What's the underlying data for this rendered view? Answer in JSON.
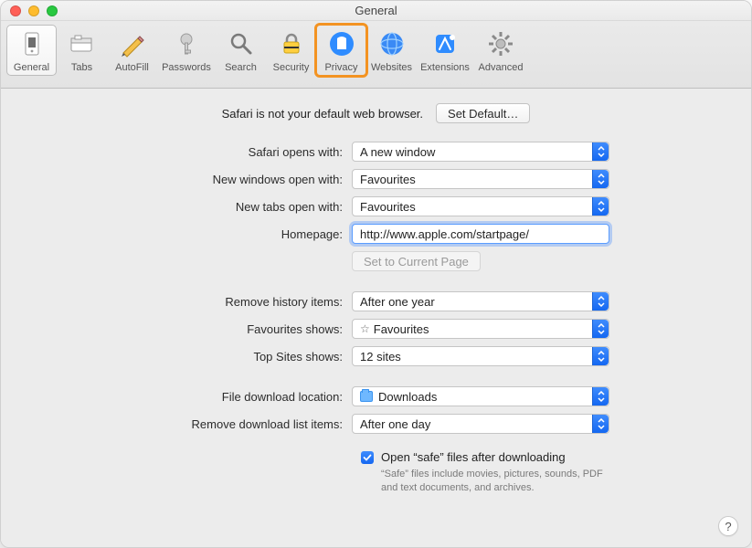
{
  "window": {
    "title": "General"
  },
  "toolbar": {
    "items": [
      {
        "id": "general",
        "label": "General"
      },
      {
        "id": "tabs",
        "label": "Tabs"
      },
      {
        "id": "autofill",
        "label": "AutoFill"
      },
      {
        "id": "passwords",
        "label": "Passwords"
      },
      {
        "id": "search",
        "label": "Search"
      },
      {
        "id": "security",
        "label": "Security"
      },
      {
        "id": "privacy",
        "label": "Privacy"
      },
      {
        "id": "websites",
        "label": "Websites"
      },
      {
        "id": "extensions",
        "label": "Extensions"
      },
      {
        "id": "advanced",
        "label": "Advanced"
      }
    ],
    "selected": "general",
    "highlighted": "privacy"
  },
  "default_browser": {
    "message": "Safari is not your default web browser.",
    "button": "Set Default…"
  },
  "form": {
    "opens_with": {
      "label": "Safari opens with:",
      "value": "A new window"
    },
    "new_windows": {
      "label": "New windows open with:",
      "value": "Favourites"
    },
    "new_tabs": {
      "label": "New tabs open with:",
      "value": "Favourites"
    },
    "homepage": {
      "label": "Homepage:",
      "value": "http://www.apple.com/startpage/"
    },
    "set_current": {
      "label": "Set to Current Page"
    },
    "remove_history": {
      "label": "Remove history items:",
      "value": "After one year"
    },
    "favourites_shows": {
      "label": "Favourites shows:",
      "value": "Favourites"
    },
    "top_sites": {
      "label": "Top Sites shows:",
      "value": "12 sites"
    },
    "download_location": {
      "label": "File download location:",
      "value": "Downloads"
    },
    "remove_downloads": {
      "label": "Remove download list items:",
      "value": "After one day"
    },
    "open_safe": {
      "checked": true,
      "label": "Open “safe” files after downloading",
      "help": "“Safe” files include movies, pictures, sounds, PDF and text documents, and archives."
    }
  },
  "help_button": "?"
}
